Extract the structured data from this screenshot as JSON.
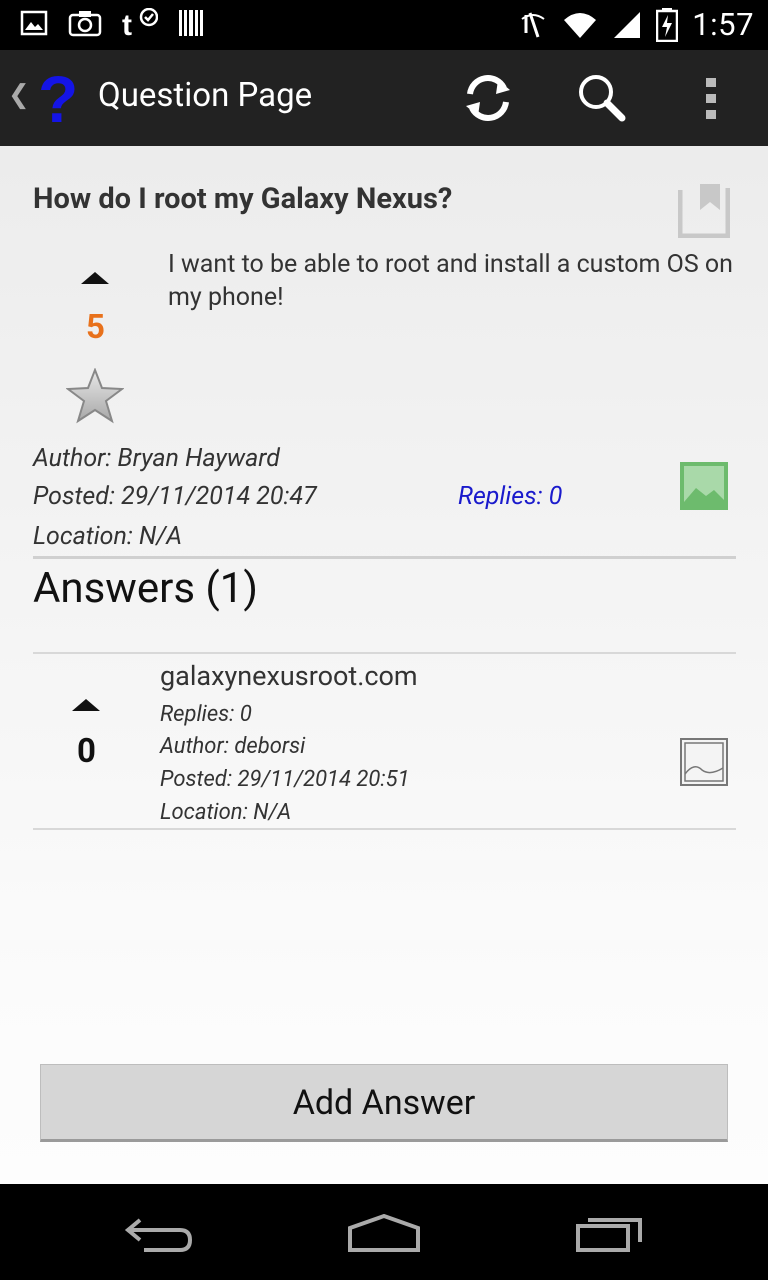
{
  "status_bar": {
    "time": "1:57",
    "left_icons": [
      "image-icon",
      "camera-icon",
      "t-check-icon",
      "barcode-icon"
    ],
    "right_icons": [
      "mute-icon",
      "wifi-icon",
      "signal-icon",
      "battery-icon"
    ]
  },
  "action_bar": {
    "title": "Question Page",
    "app_icon": "question-mark-icon",
    "actions": [
      "refresh-icon",
      "search-icon",
      "overflow-menu-icon"
    ]
  },
  "question": {
    "title": "How do I root my Galaxy Nexus?",
    "body": "I want to be able to root and install a custom OS on my phone!",
    "score": "5",
    "author": "Author: Bryan Hayward",
    "posted": "Posted: 29/11/2014  20:47",
    "location": "Location: N/A",
    "replies": "Replies: 0"
  },
  "answers_heading": "Answers (1)",
  "answers": [
    {
      "title": "galaxynexusroot.com",
      "score": "0",
      "replies": "Replies: 0",
      "author": "Author: deborsi",
      "posted": "Posted: 29/11/2014  20:51",
      "location": "Location: N/A"
    }
  ],
  "add_answer_label": "Add Answer",
  "colors": {
    "score_accent": "#e8711b",
    "replies_link": "#1a1acc",
    "action_bar_bg": "#222222",
    "image_icon_green": "#6dbb6d"
  }
}
